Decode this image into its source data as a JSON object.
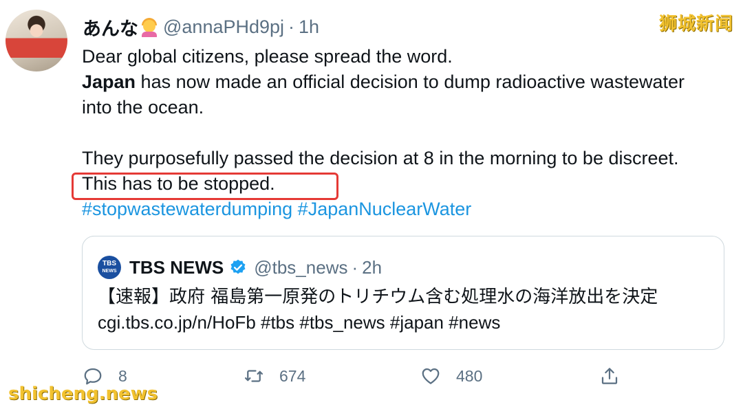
{
  "watermarks": {
    "top_right": "狮城新闻",
    "bottom_left": "shicheng.news"
  },
  "tweet": {
    "display_name": "あんな",
    "emoji": "person-gesturing-ok-emoji",
    "handle": "@annaPHd9pj",
    "separator": "·",
    "time": "1h",
    "lines": {
      "l1": "Dear global citizens, please spread the word.",
      "l2_bold": "Japan",
      "l2_rest": " has now made an official decision to dump radioactive wastewater",
      "l3": "into the ocean.",
      "l4": "They purposefully passed the decision at 8 in the morning to be discreet.",
      "l5": "This has to be stopped.",
      "hashtags": "#stopwastewaterdumping #JapanNuclearWater"
    },
    "highlight_color": "#e53935"
  },
  "quote": {
    "logo_line1": "TBS",
    "logo_line2": "NEWS",
    "name": "TBS NEWS",
    "verified_icon": "verified-badge-icon",
    "handle": "@tbs_news",
    "separator": "·",
    "time": "2h",
    "line1": "【速報】政府 福島第一原発のトリチウム含む処理水の海洋放出を決定",
    "line2": "cgi.tbs.co.jp/n/HoFb #tbs #tbs_news #japan #news"
  },
  "actions": {
    "reply_count": "8",
    "retweet_count": "674",
    "like_count": "480"
  },
  "colors": {
    "link": "#1b95e0",
    "muted": "#5b7083",
    "verified": "#1da1f2",
    "watermark": "#f2c230"
  }
}
